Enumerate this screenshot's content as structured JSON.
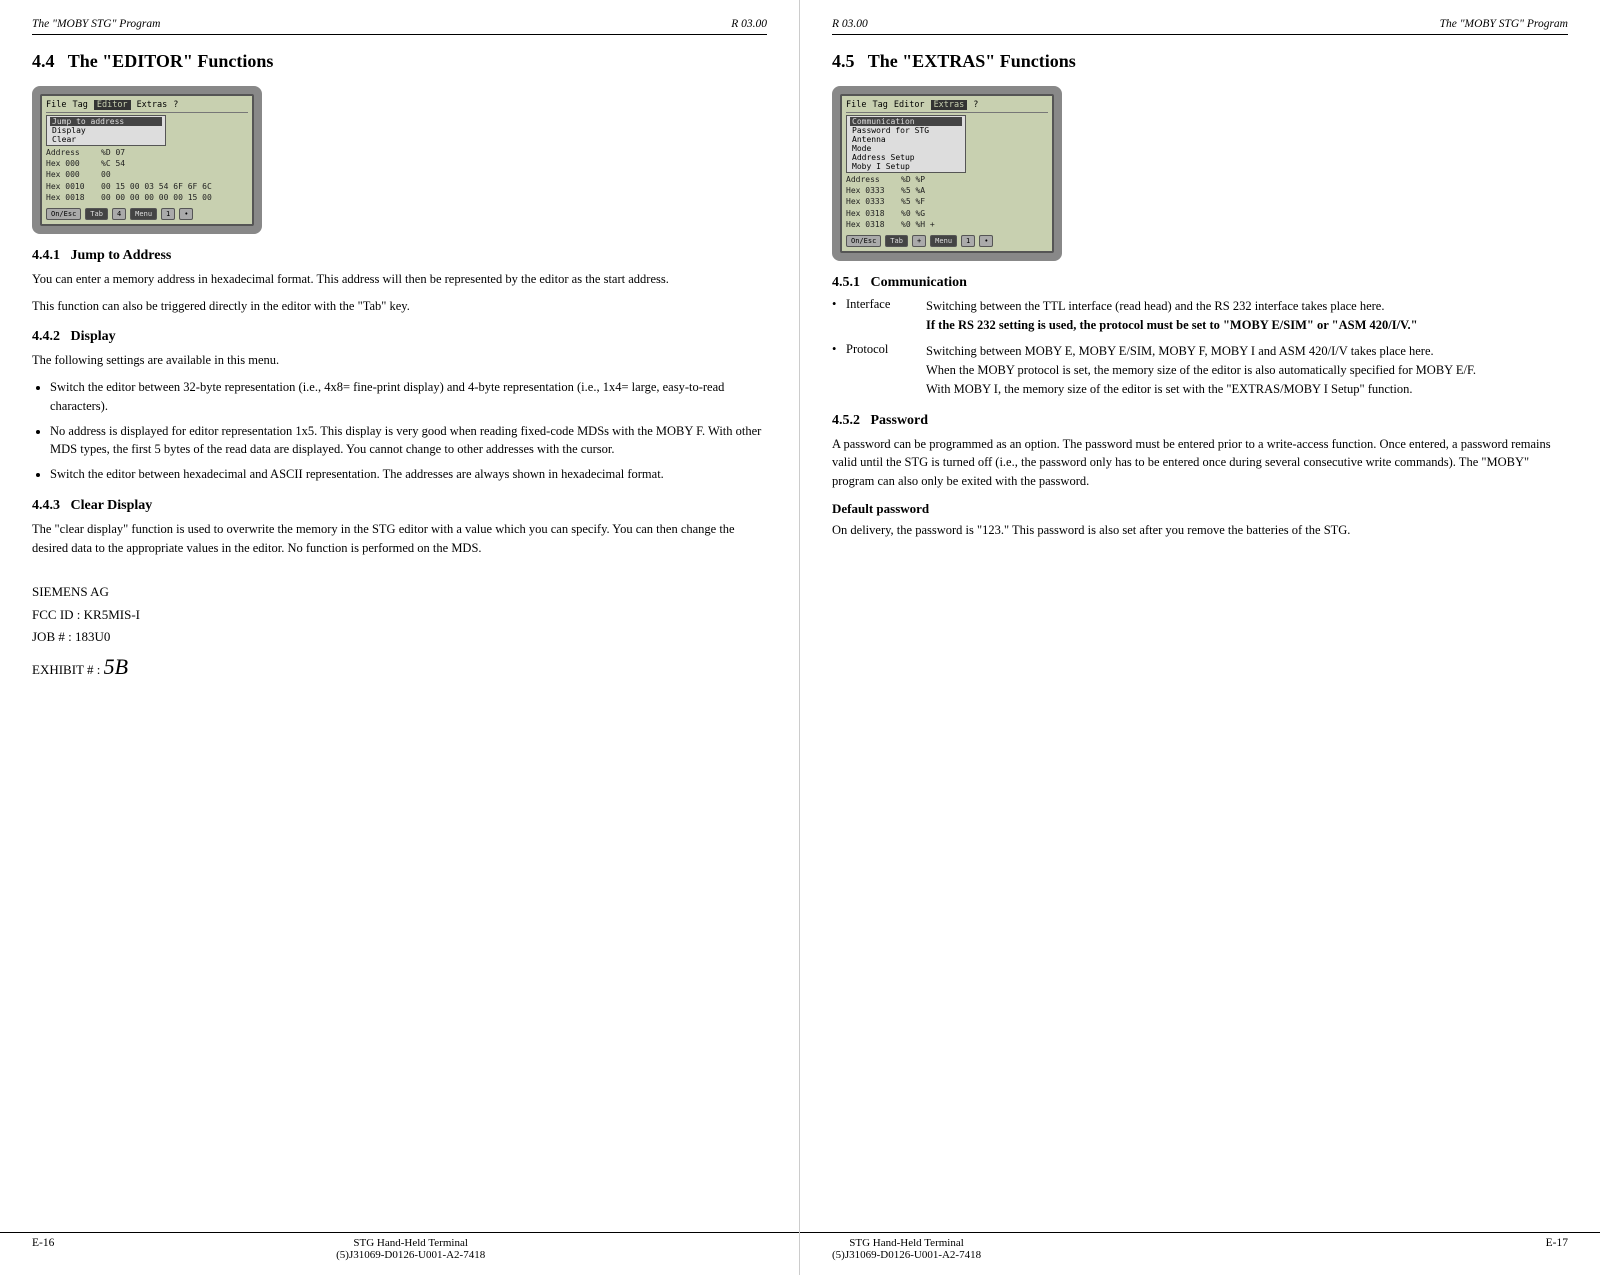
{
  "left": {
    "header": {
      "left": "The \"MOBY STG\" Program",
      "right": "R 03.00"
    },
    "section": {
      "number": "4.4",
      "title": "The \"EDITOR\" Functions"
    },
    "screen": {
      "menu": [
        "File",
        "Tag",
        "Editor",
        "Extras",
        "?"
      ],
      "active_menu": "Editor",
      "dropdown_items": [
        "Jump to address",
        "Display",
        "Clear"
      ],
      "active_dropdown": "Jump to address",
      "rows": [
        {
          "label": "Address",
          "val": "%D  07"
        },
        {
          "label": "Hex 000",
          "val": "%C  54"
        },
        {
          "label": "Hex 000",
          "val": "00"
        },
        {
          "label": "Hex 0010",
          "val": "00 15 00 03 54 6F 6F 6C"
        },
        {
          "label": "Hex 0018",
          "val": "00 00 00 00 00 00 15 00"
        }
      ],
      "bottom_btns": [
        "On/Esc",
        "Tab",
        "4",
        "Menu",
        "1",
        "•"
      ]
    },
    "subsections": [
      {
        "number": "4.4.1",
        "title": "Jump to Address",
        "paragraphs": [
          "You can enter a memory address in hexadecimal format. This address will then be represented by the editor as the start address.",
          "This function can also be triggered directly in the editor with the \"Tab\" key."
        ]
      },
      {
        "number": "4.4.2",
        "title": "Display",
        "intro": "The following settings are available in this menu.",
        "bullets": [
          "Switch the editor between 32-byte representation (i.e., 4x8= fine-print display) and 4-byte representation (i.e., 1x4= large, easy-to-read characters).",
          "No address is displayed for editor representation 1x5. This display is very good when reading fixed-code MDSs with the MOBY F. With other MDS types, the first 5 bytes of the read data are displayed. You cannot change to other addresses with the cursor.",
          "Switch the editor between hexadecimal and ASCII representation. The addresses are always shown in hexadecimal format."
        ]
      },
      {
        "number": "4.4.3",
        "title": "Clear Display",
        "paragraphs": [
          "The \"clear display\" function is used to overwrite the memory in the STG editor with a value which you can specify. You can then change the desired data to the appropriate values in the editor. No function is performed on the MDS."
        ]
      }
    ],
    "siemens": {
      "line1": "SIEMENS AG",
      "line2": "FCC ID : KR5MIS-I",
      "line3": "JOB # :  183U0",
      "line4": "EXHIBIT # :",
      "exhibit_num": "5B"
    },
    "footer": {
      "left": "E-16",
      "center_line1": "STG Hand-Held Terminal",
      "center_line2": "(5)J31069-D0126-U001-A2-7418"
    }
  },
  "right": {
    "header": {
      "left": "R 03.00",
      "right": "The \"MOBY STG\" Program"
    },
    "section": {
      "number": "4.5",
      "title": "The \"EXTRAS\" Functions"
    },
    "screen": {
      "menu": [
        "File",
        "Tag",
        "Editor",
        "Extras",
        "?"
      ],
      "active_menu": "Extras",
      "dropdown_items": [
        "Communication",
        "Password for STG",
        "Antenna",
        "Mode",
        "Address Setup",
        "Moby I Setup"
      ],
      "active_dropdown": "Communication",
      "rows": [
        {
          "label": "Address",
          "val": "%D  %P"
        },
        {
          "label": "Hex 0333",
          "val": "%5  %A"
        },
        {
          "label": "Hex 0333",
          "val": "%5  %F"
        },
        {
          "label": "Hex 0318",
          "val": "%0  %G"
        },
        {
          "label": "Hex 0318",
          "val": "%0  %H +"
        }
      ],
      "bottom_btns": [
        "On/Esc",
        "Tab",
        "+",
        "Menu",
        "1",
        "•"
      ]
    },
    "subsections": [
      {
        "number": "4.5.1",
        "title": "Communication",
        "items": [
          {
            "label": "Interface",
            "content": "Switching between the TTL interface (read head) and the RS 232 interface takes place here.",
            "bold": "If the RS 232 setting is used, the protocol must be set to \"MOBY E/SIM\" or \"ASM 420/I/V.\""
          },
          {
            "label": "Protocol",
            "content": "Switching between MOBY E, MOBY E/SIM, MOBY F, MOBY I and ASM 420/I/V takes place here.\nWhen the MOBY protocol is set, the memory size of the editor is also automatically specified for MOBY E/F.\nWith MOBY I, the memory size of the editor is set with the \"EXTRAS/MOBY I Setup\" function.",
            "bold": ""
          }
        ]
      },
      {
        "number": "4.5.2",
        "title": "Password",
        "paragraphs": [
          "A password can be programmed as an option. The password must be entered prior to a write-access function. Once entered, a password remains valid until the STG is turned off (i.e., the password only has to be entered once during several consecutive write commands). The \"MOBY\" program can also only be exited with the password."
        ],
        "subheading": "Default password",
        "subparagraph": "On delivery, the password is \"123.\" This password is also set after you remove the batteries of the STG."
      }
    ],
    "footer": {
      "left": "STG Hand-Held Terminal",
      "left2": "(5)J31069-D0126-U001-A2-7418",
      "right": "E-17"
    }
  }
}
